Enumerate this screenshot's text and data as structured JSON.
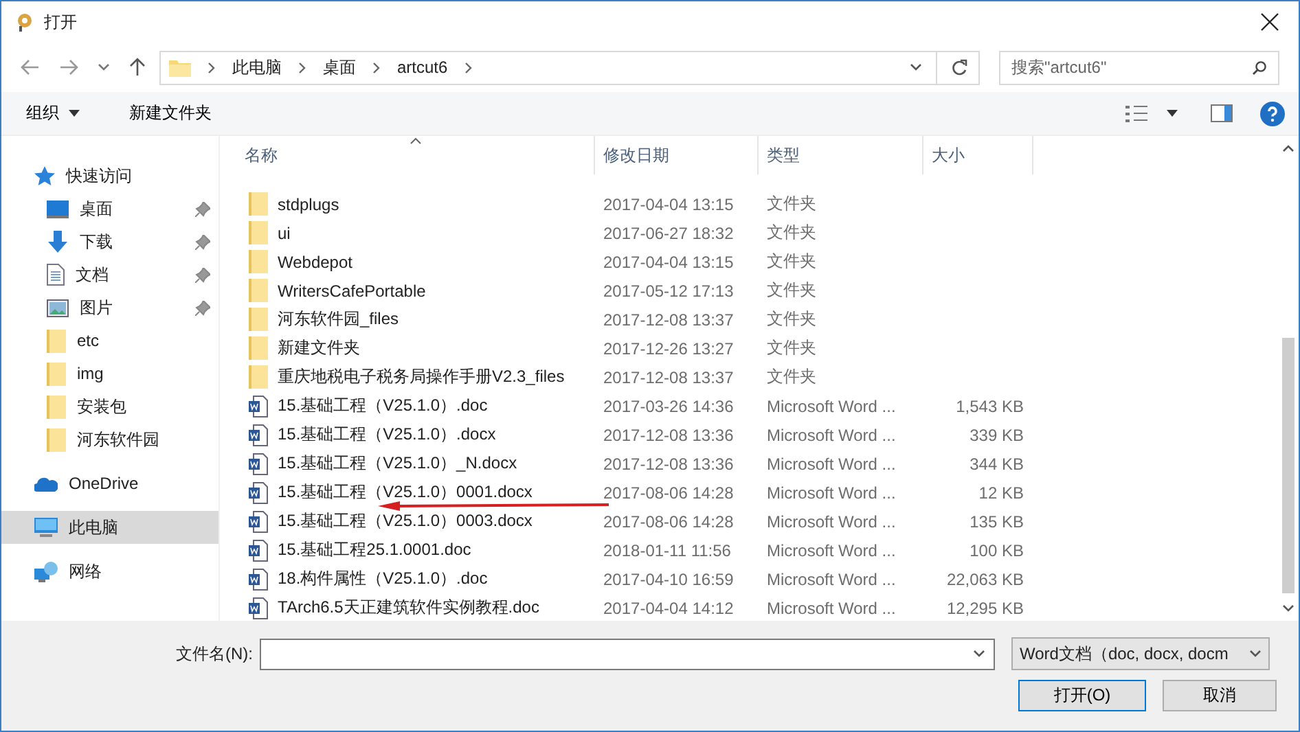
{
  "window": {
    "title": "打开"
  },
  "address": {
    "breadcrumbs": [
      "此电脑",
      "桌面",
      "artcut6"
    ]
  },
  "search": {
    "placeholder": "搜索\"artcut6\""
  },
  "toolbar": {
    "organize": "组织",
    "new_folder": "新建文件夹"
  },
  "sidebar": {
    "items": [
      {
        "label": "快速访问",
        "kind": "quick",
        "selected": false,
        "children": [
          {
            "label": "桌面",
            "kind": "desktop",
            "pinned": true,
            "selected": false
          },
          {
            "label": "下载",
            "kind": "download",
            "pinned": true,
            "selected": false
          },
          {
            "label": "文档",
            "kind": "document",
            "pinned": true,
            "selected": false
          },
          {
            "label": "图片",
            "kind": "picture",
            "pinned": true,
            "selected": false
          },
          {
            "label": "etc",
            "kind": "folder",
            "pinned": false,
            "selected": false
          },
          {
            "label": "img",
            "kind": "folder",
            "pinned": false,
            "selected": false
          },
          {
            "label": "安装包",
            "kind": "folder",
            "pinned": false,
            "selected": false
          },
          {
            "label": "河东软件园",
            "kind": "folder",
            "pinned": false,
            "selected": false
          }
        ]
      },
      {
        "label": "OneDrive",
        "kind": "cloud",
        "selected": false
      },
      {
        "label": "此电脑",
        "kind": "computer",
        "selected": true
      },
      {
        "label": "网络",
        "kind": "network",
        "selected": false
      }
    ]
  },
  "table": {
    "columns": [
      "名称",
      "修改日期",
      "类型",
      "大小"
    ],
    "rows": [
      {
        "kind": "folder",
        "name": "stdplugs",
        "modified": "2017-04-04 13:15",
        "type": "文件夹"
      },
      {
        "kind": "folder",
        "name": "ui",
        "modified": "2017-06-27 18:32",
        "type": "文件夹"
      },
      {
        "kind": "folder",
        "name": "Webdepot",
        "modified": "2017-04-04 13:15",
        "type": "文件夹"
      },
      {
        "kind": "folder",
        "name": "WritersCafePortable",
        "modified": "2017-05-12 17:13",
        "type": "文件夹"
      },
      {
        "kind": "folder",
        "name": "河东软件园_files",
        "modified": "2017-12-08 13:37",
        "type": "文件夹"
      },
      {
        "kind": "folder",
        "name": "新建文件夹",
        "modified": "2017-12-26 13:27",
        "type": "文件夹"
      },
      {
        "kind": "folder",
        "name": "重庆地税电子税务局操作手册V2.3_files",
        "modified": "2017-12-08 13:37",
        "type": "文件夹"
      },
      {
        "kind": "word",
        "name": "15.基础工程（V25.1.0）.doc",
        "modified": "2017-03-26 14:36",
        "type": "Microsoft Word ...",
        "size": "1,543 KB"
      },
      {
        "kind": "word",
        "name": "15.基础工程（V25.1.0）.docx",
        "modified": "2017-12-08 13:36",
        "type": "Microsoft Word ...",
        "size": "339 KB"
      },
      {
        "kind": "word",
        "name": "15.基础工程（V25.1.0）_N.docx",
        "modified": "2017-12-08 13:36",
        "type": "Microsoft Word ...",
        "size": "344 KB"
      },
      {
        "kind": "word",
        "name": "15.基础工程（V25.1.0）0001.docx",
        "modified": "2017-08-06 14:28",
        "type": "Microsoft Word ...",
        "size": "12 KB"
      },
      {
        "kind": "word",
        "name": "15.基础工程（V25.1.0）0003.docx",
        "modified": "2017-08-06 14:28",
        "type": "Microsoft Word ...",
        "size": "135 KB"
      },
      {
        "kind": "word",
        "name": "15.基础工程25.1.0001.doc",
        "modified": "2018-01-11 11:56",
        "type": "Microsoft Word ...",
        "size": "100 KB"
      },
      {
        "kind": "word",
        "name": "18.构件属性（V25.1.0）.doc",
        "modified": "2017-04-10 16:59",
        "type": "Microsoft Word ...",
        "size": "22,063 KB"
      },
      {
        "kind": "word",
        "name": "TArch6.5天正建筑软件实例教程.doc",
        "modified": "2017-04-04 14:12",
        "type": "Microsoft Word ...",
        "size": "12,295 KB"
      }
    ]
  },
  "footer": {
    "filename_label": "文件名(N):",
    "filter": "Word文档（doc, docx, docm",
    "buttons": [
      "打开(O)",
      "取消"
    ]
  }
}
